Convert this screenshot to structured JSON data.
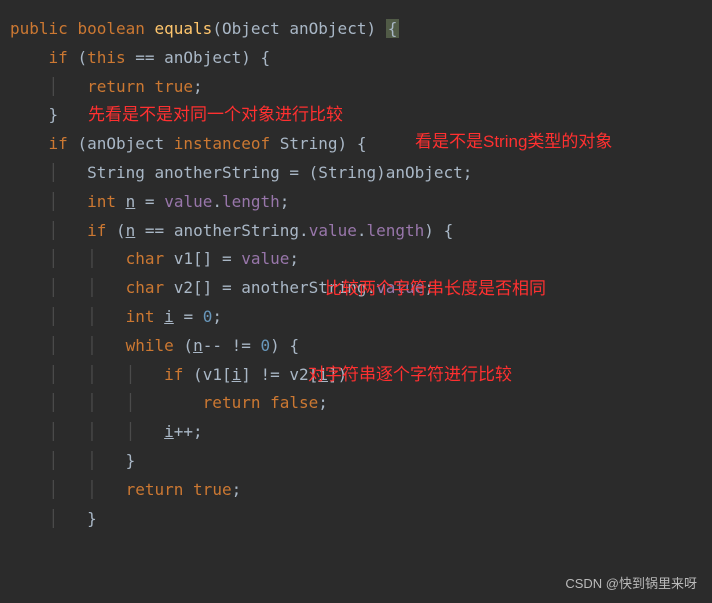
{
  "code": {
    "l1_public": "public",
    "l1_boolean": "boolean",
    "l1_method": "equals",
    "l1_param_type": "Object",
    "l1_param_name": "anObject",
    "l1_brace": "{",
    "l2_if": "if",
    "l2_this": "this",
    "l2_eq": "==",
    "l2_var": "anObject",
    "l2_brace": "{",
    "l3_return": "return",
    "l3_true": "true",
    "l4_brace": "}",
    "l5_if": "if",
    "l5_var": "anObject",
    "l5_instanceof": "instanceof",
    "l5_type": "String",
    "l5_brace": "{",
    "l6_type1": "String",
    "l6_var": "anotherString",
    "l6_eq": "=",
    "l6_cast": "(String)",
    "l6_rhs": "anObject",
    "l7_int": "int",
    "l7_var": "n",
    "l7_eq": "=",
    "l7_field": "value",
    "l7_dot": ".",
    "l7_prop": "length",
    "l8_if": "if",
    "l8_var": "n",
    "l8_eq": "==",
    "l8_rhs1": "anotherString",
    "l8_dot1": ".",
    "l8_rhs2": "value",
    "l8_dot2": ".",
    "l8_rhs3": "length",
    "l8_brace": "{",
    "l9_char": "char",
    "l9_var": "v1",
    "l9_brackets": "[]",
    "l9_eq": "=",
    "l9_rhs": "value",
    "l10_char": "char",
    "l10_var": "v2",
    "l10_brackets": "[]",
    "l10_eq": "=",
    "l10_rhs1": "anotherString",
    "l10_dot": ".",
    "l10_rhs2": "value",
    "l11_int": "int",
    "l11_var": "i",
    "l11_eq": "=",
    "l11_val": "0",
    "l12_while": "while",
    "l12_var": "n",
    "l12_dec": "--",
    "l12_neq": "!=",
    "l12_val": "0",
    "l12_brace": "{",
    "l13_if": "if",
    "l13_v1": "v1",
    "l13_i1": "i",
    "l13_neq": "!=",
    "l13_v2": "v2",
    "l13_i2": "i",
    "l14_return": "return",
    "l14_false": "false",
    "l15_var": "i",
    "l15_inc": "++",
    "l16_brace": "}",
    "l17_return": "return",
    "l17_true": "true",
    "l18_brace": "}"
  },
  "annotations": {
    "a1": "先看是不是对同一个对象进行比较",
    "a2": "看是不是String类型的对象",
    "a3": "比较两个字符串长度是否相同",
    "a4": "对字符串逐个字符进行比较"
  },
  "watermark": "CSDN @快到锅里来呀"
}
